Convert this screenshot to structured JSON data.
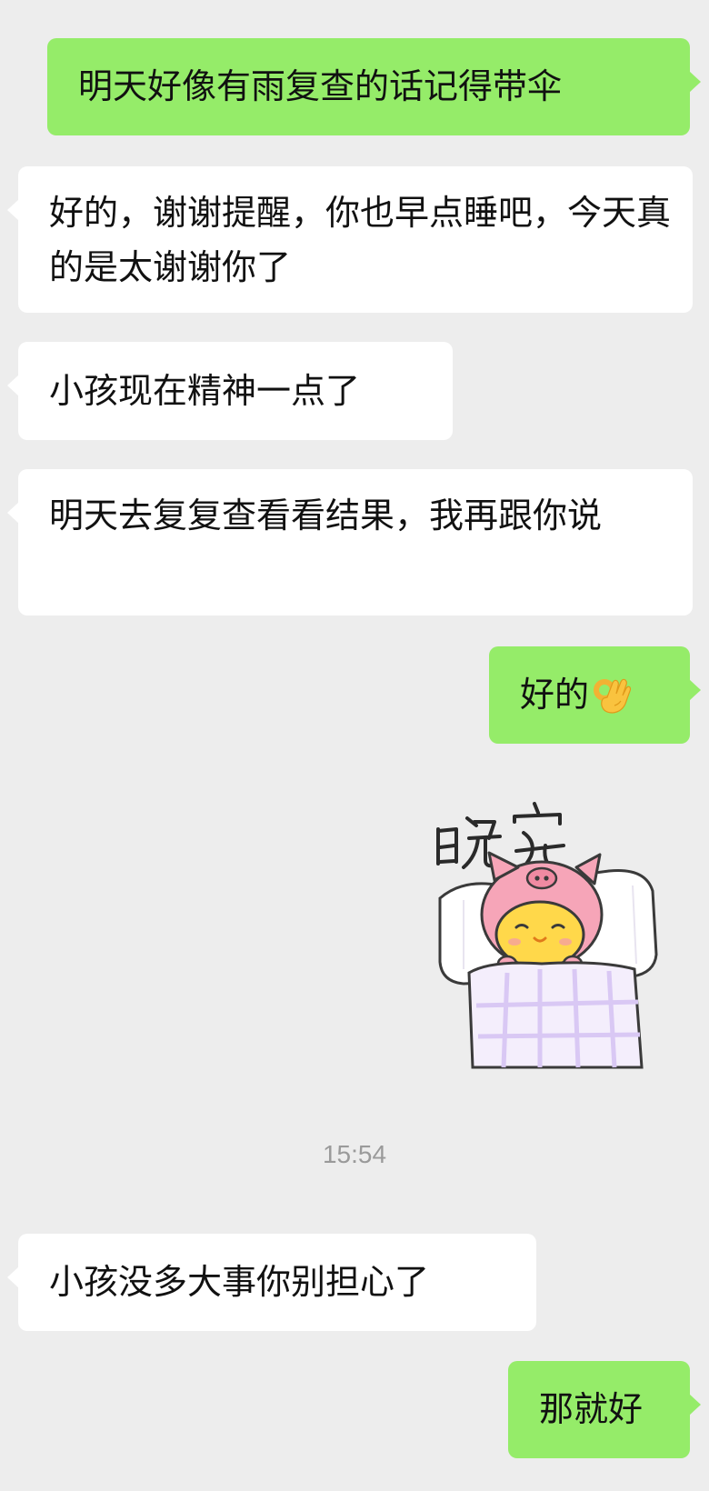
{
  "messages": [
    {
      "id": "m1",
      "side": "out",
      "text": "明天好像有雨复查的话记得带伞"
    },
    {
      "id": "m2",
      "side": "in",
      "text": "好的，谢谢提醒，你也早点睡吧，今天真的是太谢谢你了"
    },
    {
      "id": "m3",
      "side": "in",
      "text": "小孩现在精神一点了"
    },
    {
      "id": "m4",
      "side": "in",
      "text": "明天去复复查看看结果，我再跟你说"
    },
    {
      "id": "m5",
      "side": "out",
      "text": "好的",
      "emoji": "ok-hand-emoji"
    },
    {
      "id": "m6",
      "side": "out",
      "type": "sticker",
      "text": "晚安",
      "sticker": "sleeping-pig-chick-sticker"
    },
    {
      "id": "m7",
      "side": "in",
      "text": "小孩没多大事你别担心了"
    },
    {
      "id": "m8",
      "side": "out",
      "text": "那就好"
    }
  ],
  "timestamp": "15:54",
  "colors": {
    "background": "#ededed",
    "outgoing_bubble": "#95ec69",
    "incoming_bubble": "#ffffff",
    "timestamp_text": "#9a9a9a"
  }
}
